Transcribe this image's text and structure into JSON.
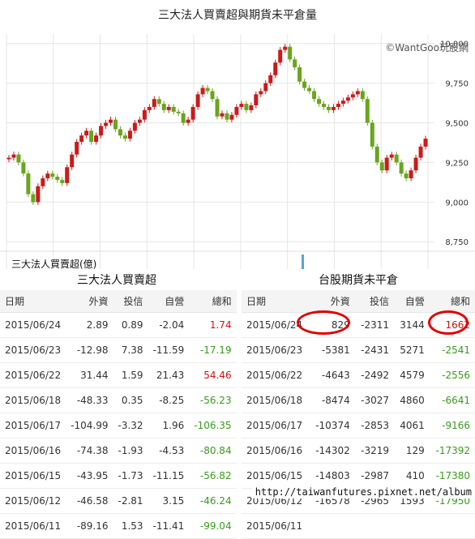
{
  "chart": {
    "title": "三大法人買賣超與期貨未平倉量",
    "watermark": "©WantGoo玩股網",
    "sub_label": "三大法人買賣超(億)",
    "y_ticks": [
      "10,000",
      "9,750",
      "9,500",
      "9,250",
      "9,000",
      "8,750"
    ],
    "colors": {
      "up": "#cc1a1a",
      "down": "#6aa51e",
      "grid": "#e6e6e6",
      "marker": "#5ba3d6"
    }
  },
  "chart_data": {
    "type": "candlestick",
    "y_range": [
      8700,
      10060
    ],
    "y_ticks": [
      10000,
      9750,
      9500,
      9250,
      9000,
      8750
    ],
    "closes": [
      9280,
      9300,
      9250,
      9180,
      9050,
      9000,
      9100,
      9150,
      9180,
      9160,
      9140,
      9120,
      9220,
      9300,
      9380,
      9420,
      9450,
      9380,
      9420,
      9480,
      9500,
      9520,
      9460,
      9420,
      9400,
      9450,
      9500,
      9520,
      9580,
      9600,
      9650,
      9620,
      9580,
      9600,
      9570,
      9560,
      9500,
      9520,
      9600,
      9680,
      9720,
      9700,
      9650,
      9540,
      9560,
      9520,
      9550,
      9600,
      9620,
      9580,
      9610,
      9680,
      9700,
      9750,
      9800,
      9880,
      9960,
      9980,
      9900,
      9850,
      9760,
      9720,
      9700,
      9650,
      9620,
      9600,
      9580,
      9600,
      9620,
      9640,
      9660,
      9680,
      9700,
      9650,
      9500,
      9350,
      9250,
      9200,
      9280,
      9300,
      9250,
      9180,
      9150,
      9200,
      9280,
      9350,
      9400
    ]
  },
  "left_table": {
    "title": "三大法人買賣超",
    "headers": [
      "日期",
      "外資",
      "投信",
      "自營",
      "總和"
    ],
    "rows": [
      [
        "2015/06/24",
        "2.89",
        "0.89",
        "-2.04",
        "1.74"
      ],
      [
        "2015/06/23",
        "-12.98",
        "7.38",
        "-11.59",
        "-17.19"
      ],
      [
        "2015/06/22",
        "31.44",
        "1.59",
        "21.43",
        "54.46"
      ],
      [
        "2015/06/18",
        "-48.33",
        "0.35",
        "-8.25",
        "-56.23"
      ],
      [
        "2015/06/17",
        "-104.99",
        "-3.32",
        "1.96",
        "-106.35"
      ],
      [
        "2015/06/16",
        "-74.38",
        "-1.93",
        "-4.53",
        "-80.84"
      ],
      [
        "2015/06/15",
        "-43.95",
        "-1.73",
        "-11.15",
        "-56.82"
      ],
      [
        "2015/06/12",
        "-46.58",
        "-2.81",
        "3.15",
        "-46.24"
      ],
      [
        "2015/06/11",
        "-89.16",
        "1.53",
        "-11.41",
        "-99.04"
      ]
    ]
  },
  "right_table": {
    "title": "台股期貨未平倉",
    "headers": [
      "日期",
      "外資",
      "投信",
      "自營",
      "總和"
    ],
    "rows": [
      [
        "2015/06/24",
        "829",
        "-2311",
        "3144",
        "1662"
      ],
      [
        "2015/06/23",
        "-5381",
        "-2431",
        "5271",
        "-2541"
      ],
      [
        "2015/06/22",
        "-4643",
        "-2492",
        "4579",
        "-2556"
      ],
      [
        "2015/06/18",
        "-8474",
        "-3027",
        "4860",
        "-6641"
      ],
      [
        "2015/06/17",
        "-10374",
        "-2853",
        "4061",
        "-9166"
      ],
      [
        "2015/06/16",
        "-14302",
        "-3219",
        "129",
        "-17392"
      ],
      [
        "2015/06/15",
        "-14803",
        "-2987",
        "410",
        "-17380"
      ],
      [
        "2015/06/12",
        "-16578",
        "-2965",
        "1593",
        "-17950"
      ],
      [
        "2015/06/11",
        "",
        "",
        "",
        ""
      ]
    ]
  },
  "footer_url": "http://taiwanfutures.pixnet.net/album"
}
